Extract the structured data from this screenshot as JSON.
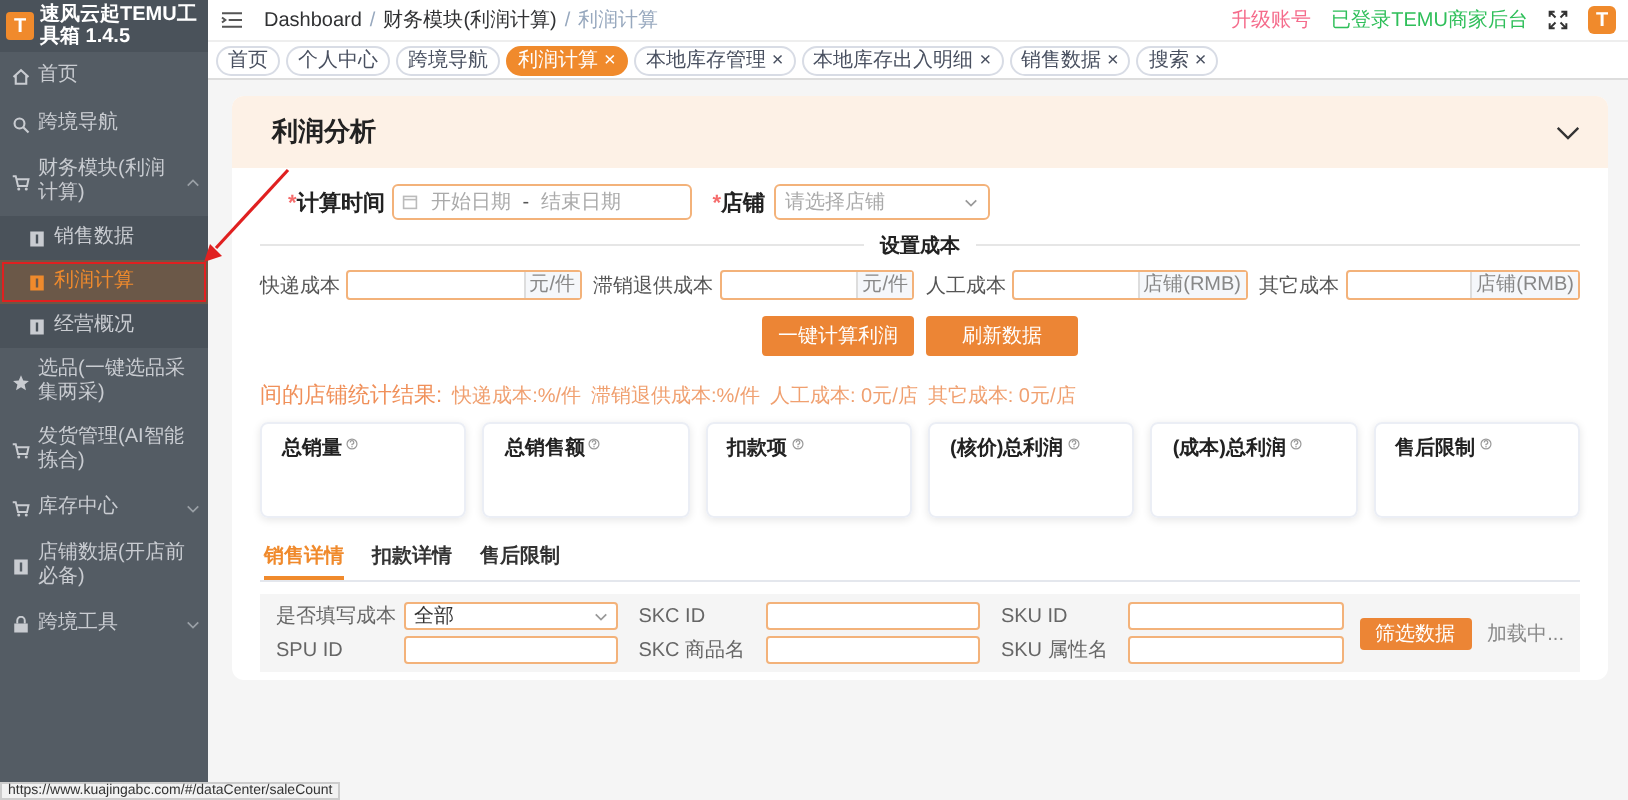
{
  "app": {
    "logo_letter": "T",
    "title": "速风云起TEMU工具箱 1.4.5"
  },
  "sidebar": {
    "items": [
      {
        "label": "首页",
        "expanded": false
      },
      {
        "label": "跨境导航",
        "expanded": false
      },
      {
        "label": "财务模块(利润计算)",
        "expanded": true,
        "children": [
          {
            "label": "销售数据",
            "selected": false
          },
          {
            "label": "利润计算",
            "selected": true
          },
          {
            "label": "经营概况",
            "selected": false
          }
        ]
      },
      {
        "label": "选品(一键选品采集两采)",
        "expanded": false
      },
      {
        "label": "发货管理(AI智能拣合)",
        "expanded": false
      },
      {
        "label": "库存中心",
        "expanded": false,
        "collapsible": true
      },
      {
        "label": "店铺数据(开店前必备)",
        "expanded": false
      },
      {
        "label": "跨境工具",
        "expanded": false,
        "collapsible": true
      }
    ]
  },
  "breadcrumb": {
    "separator": "/",
    "items": [
      "Dashboard",
      "财务模块(利润计算)",
      "利润计算"
    ]
  },
  "header_right": {
    "upgrade": "升级账号",
    "login_status": "已登录TEMU商家后台",
    "avatar_letter": "T"
  },
  "tabs": [
    {
      "label": "首页",
      "selected": false
    },
    {
      "label": "个人中心",
      "selected": false
    },
    {
      "label": "跨境导航",
      "selected": false
    },
    {
      "label": "利润计算",
      "selected": true,
      "close": "×"
    },
    {
      "label": "本地库存管理",
      "selected": false,
      "close": "×"
    },
    {
      "label": "本地库存出入明细",
      "selected": false,
      "close": "×"
    },
    {
      "label": "销售数据",
      "selected": false,
      "close": "×"
    },
    {
      "label": "搜索",
      "selected": false,
      "close": "×"
    }
  ],
  "page_title": "利润分析",
  "form": {
    "required_mark": "*",
    "time_label": "计算时间",
    "start_placeholder": "开始日期",
    "separator": "-",
    "end_placeholder": "结束日期",
    "shop_label": "店铺",
    "shop_placeholder": "请选择店铺"
  },
  "cost_title": "设置成本",
  "costs": [
    {
      "label": "快递成本",
      "unit": "元/件"
    },
    {
      "label": "滞销退供成本",
      "unit": "元/件"
    },
    {
      "label": "人工成本",
      "unit": "店铺(RMB)"
    },
    {
      "label": "其它成本",
      "unit": "店铺(RMB)"
    }
  ],
  "actions": [
    "一键计算利润",
    "刷新数据"
  ],
  "summary": {
    "heading": "间的店铺统计结果:",
    "details": [
      "快递成本:%/件",
      "滞销退供成本:%/件",
      "人工成本: 0元/店",
      "其它成本: 0元/店"
    ]
  },
  "stats": [
    "总销量",
    "总销售额",
    "扣款项",
    "(核价)总利润",
    "(成本)总利润",
    "售后限制"
  ],
  "detail_tabs": [
    {
      "label": "销售详情",
      "selected": true
    },
    {
      "label": "扣款详情",
      "selected": false
    },
    {
      "label": "售后限制",
      "selected": false
    }
  ],
  "filters": [
    {
      "label": "是否填写成本",
      "kind": "select",
      "value": "全部"
    },
    {
      "label": "SKC ID",
      "kind": "input"
    },
    {
      "label": "SKU ID",
      "kind": "input"
    },
    {
      "label": "SPU ID",
      "kind": "input"
    },
    {
      "label": "SKC 商品名",
      "kind": "input"
    },
    {
      "label": "SKU 属性名",
      "kind": "input"
    }
  ],
  "filter_button": "筛选数据",
  "loading_text": "加载中...",
  "status_url": "https://www.kuajingabc.com/#/dataCenter/saleCount"
}
